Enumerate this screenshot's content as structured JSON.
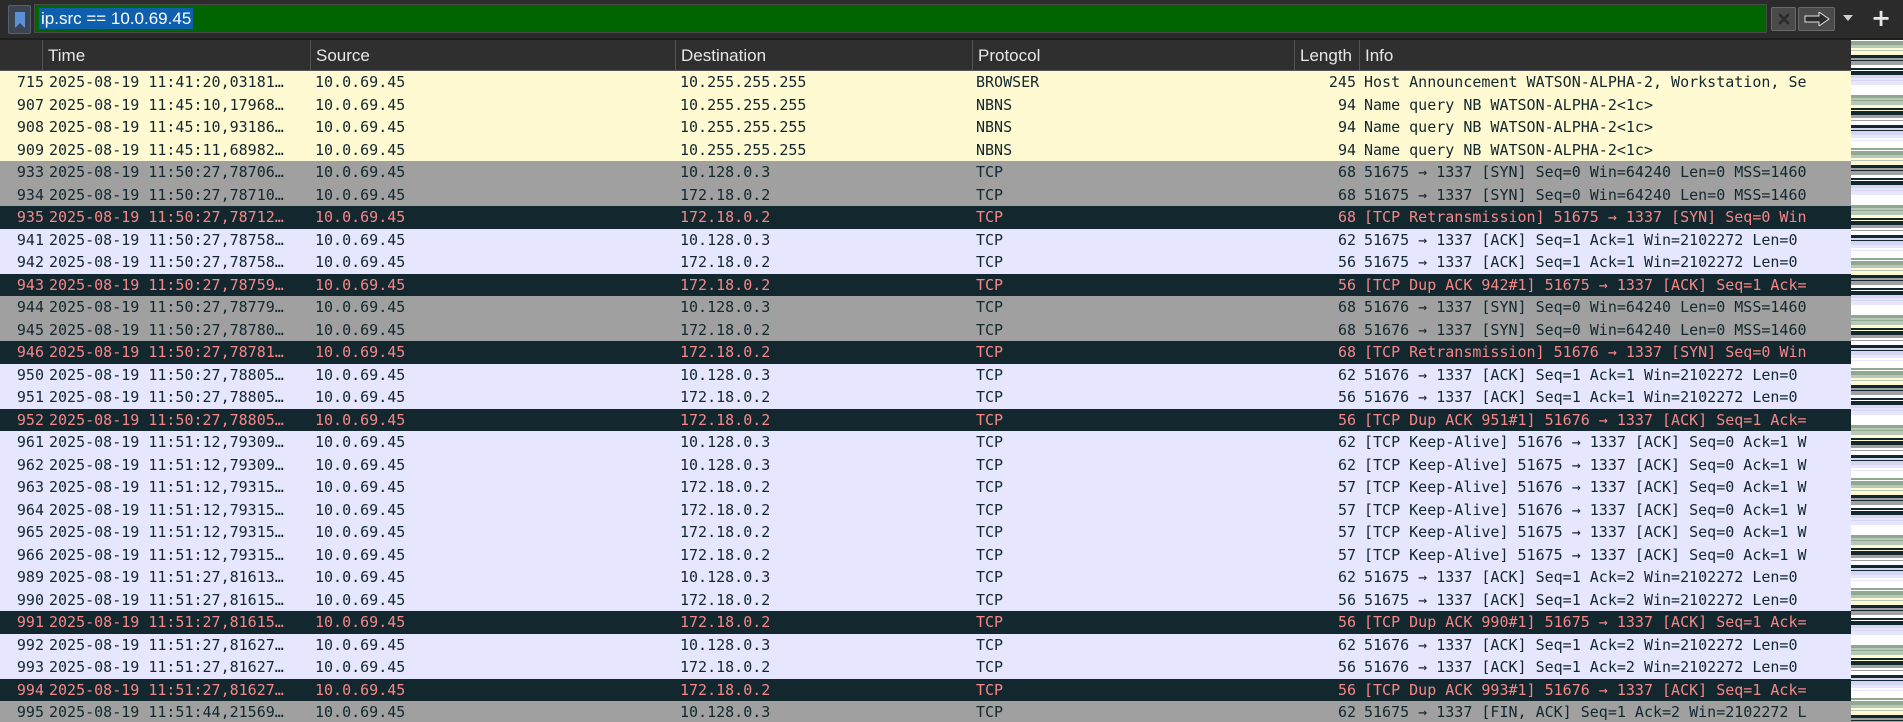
{
  "filter": {
    "value": "ip.src == 10.0.69.45",
    "bookmark_icon": "bookmark-icon",
    "clear_icon": "clear-x-icon",
    "apply_icon": "arrow-right-icon",
    "dropdown_icon": "chevron-down-icon",
    "add_icon": "plus-icon",
    "background_color": "#006400"
  },
  "columns": {
    "no": "",
    "time": "Time",
    "source": "Source",
    "destination": "Destination",
    "protocol": "Protocol",
    "length": "Length",
    "info": "Info"
  },
  "colors": {
    "yellow": "#fffad2",
    "gray": "#a0a0a0",
    "lavender": "#e7e6ff",
    "dark": "#12272e",
    "dark_text": "#f78787"
  },
  "packets": [
    {
      "no": "715",
      "time": "2025-08-19 11:41:20,03181…",
      "src": "10.0.69.45",
      "dst": "10.255.255.255",
      "proto": "BROWSER",
      "len": "245",
      "info": "Host Announcement WATSON-ALPHA-2, Workstation, Se",
      "style": "yellow"
    },
    {
      "no": "907",
      "time": "2025-08-19 11:45:10,17968…",
      "src": "10.0.69.45",
      "dst": "10.255.255.255",
      "proto": "NBNS",
      "len": "94",
      "info": "Name query NB WATSON-ALPHA-2<1c>",
      "style": "yellow"
    },
    {
      "no": "908",
      "time": "2025-08-19 11:45:10,93186…",
      "src": "10.0.69.45",
      "dst": "10.255.255.255",
      "proto": "NBNS",
      "len": "94",
      "info": "Name query NB WATSON-ALPHA-2<1c>",
      "style": "yellow"
    },
    {
      "no": "909",
      "time": "2025-08-19 11:45:11,68982…",
      "src": "10.0.69.45",
      "dst": "10.255.255.255",
      "proto": "NBNS",
      "len": "94",
      "info": "Name query NB WATSON-ALPHA-2<1c>",
      "style": "yellow"
    },
    {
      "no": "933",
      "time": "2025-08-19 11:50:27,78706…",
      "src": "10.0.69.45",
      "dst": "10.128.0.3",
      "proto": "TCP",
      "len": "68",
      "info": "51675 → 1337 [SYN] Seq=0 Win=64240 Len=0 MSS=1460",
      "style": "gray"
    },
    {
      "no": "934",
      "time": "2025-08-19 11:50:27,78710…",
      "src": "10.0.69.45",
      "dst": "172.18.0.2",
      "proto": "TCP",
      "len": "68",
      "info": "51675 → 1337 [SYN] Seq=0 Win=64240 Len=0 MSS=1460",
      "style": "gray"
    },
    {
      "no": "935",
      "time": "2025-08-19 11:50:27,78712…",
      "src": "10.0.69.45",
      "dst": "172.18.0.2",
      "proto": "TCP",
      "len": "68",
      "info": "[TCP Retransmission] 51675 → 1337 [SYN] Seq=0 Win",
      "style": "dark"
    },
    {
      "no": "941",
      "time": "2025-08-19 11:50:27,78758…",
      "src": "10.0.69.45",
      "dst": "10.128.0.3",
      "proto": "TCP",
      "len": "62",
      "info": "51675 → 1337 [ACK] Seq=1 Ack=1 Win=2102272 Len=0",
      "style": "lav"
    },
    {
      "no": "942",
      "time": "2025-08-19 11:50:27,78758…",
      "src": "10.0.69.45",
      "dst": "172.18.0.2",
      "proto": "TCP",
      "len": "56",
      "info": "51675 → 1337 [ACK] Seq=1 Ack=1 Win=2102272 Len=0",
      "style": "lav"
    },
    {
      "no": "943",
      "time": "2025-08-19 11:50:27,78759…",
      "src": "10.0.69.45",
      "dst": "172.18.0.2",
      "proto": "TCP",
      "len": "56",
      "info": "[TCP Dup ACK 942#1] 51675 → 1337 [ACK] Seq=1 Ack=",
      "style": "dark"
    },
    {
      "no": "944",
      "time": "2025-08-19 11:50:27,78779…",
      "src": "10.0.69.45",
      "dst": "10.128.0.3",
      "proto": "TCP",
      "len": "68",
      "info": "51676 → 1337 [SYN] Seq=0 Win=64240 Len=0 MSS=1460",
      "style": "gray"
    },
    {
      "no": "945",
      "time": "2025-08-19 11:50:27,78780…",
      "src": "10.0.69.45",
      "dst": "172.18.0.2",
      "proto": "TCP",
      "len": "68",
      "info": "51676 → 1337 [SYN] Seq=0 Win=64240 Len=0 MSS=1460",
      "style": "gray"
    },
    {
      "no": "946",
      "time": "2025-08-19 11:50:27,78781…",
      "src": "10.0.69.45",
      "dst": "172.18.0.2",
      "proto": "TCP",
      "len": "68",
      "info": "[TCP Retransmission] 51676 → 1337 [SYN] Seq=0 Win",
      "style": "dark"
    },
    {
      "no": "950",
      "time": "2025-08-19 11:50:27,78805…",
      "src": "10.0.69.45",
      "dst": "10.128.0.3",
      "proto": "TCP",
      "len": "62",
      "info": "51676 → 1337 [ACK] Seq=1 Ack=1 Win=2102272 Len=0",
      "style": "lav"
    },
    {
      "no": "951",
      "time": "2025-08-19 11:50:27,78805…",
      "src": "10.0.69.45",
      "dst": "172.18.0.2",
      "proto": "TCP",
      "len": "56",
      "info": "51676 → 1337 [ACK] Seq=1 Ack=1 Win=2102272 Len=0",
      "style": "lav"
    },
    {
      "no": "952",
      "time": "2025-08-19 11:50:27,78805…",
      "src": "10.0.69.45",
      "dst": "172.18.0.2",
      "proto": "TCP",
      "len": "56",
      "info": "[TCP Dup ACK 951#1] 51676 → 1337 [ACK] Seq=1 Ack=",
      "style": "dark"
    },
    {
      "no": "961",
      "time": "2025-08-19 11:51:12,79309…",
      "src": "10.0.69.45",
      "dst": "10.128.0.3",
      "proto": "TCP",
      "len": "62",
      "info": "[TCP Keep-Alive] 51676 → 1337 [ACK] Seq=0 Ack=1 W",
      "style": "lav"
    },
    {
      "no": "962",
      "time": "2025-08-19 11:51:12,79309…",
      "src": "10.0.69.45",
      "dst": "10.128.0.3",
      "proto": "TCP",
      "len": "62",
      "info": "[TCP Keep-Alive] 51675 → 1337 [ACK] Seq=0 Ack=1 W",
      "style": "lav"
    },
    {
      "no": "963",
      "time": "2025-08-19 11:51:12,79315…",
      "src": "10.0.69.45",
      "dst": "172.18.0.2",
      "proto": "TCP",
      "len": "57",
      "info": "[TCP Keep-Alive] 51676 → 1337 [ACK] Seq=0 Ack=1 W",
      "style": "lav"
    },
    {
      "no": "964",
      "time": "2025-08-19 11:51:12,79315…",
      "src": "10.0.69.45",
      "dst": "172.18.0.2",
      "proto": "TCP",
      "len": "57",
      "info": "[TCP Keep-Alive] 51676 → 1337 [ACK] Seq=0 Ack=1 W",
      "style": "lav"
    },
    {
      "no": "965",
      "time": "2025-08-19 11:51:12,79315…",
      "src": "10.0.69.45",
      "dst": "172.18.0.2",
      "proto": "TCP",
      "len": "57",
      "info": "[TCP Keep-Alive] 51675 → 1337 [ACK] Seq=0 Ack=1 W",
      "style": "lav"
    },
    {
      "no": "966",
      "time": "2025-08-19 11:51:12,79315…",
      "src": "10.0.69.45",
      "dst": "172.18.0.2",
      "proto": "TCP",
      "len": "57",
      "info": "[TCP Keep-Alive] 51675 → 1337 [ACK] Seq=0 Ack=1 W",
      "style": "lav"
    },
    {
      "no": "989",
      "time": "2025-08-19 11:51:27,81613…",
      "src": "10.0.69.45",
      "dst": "10.128.0.3",
      "proto": "TCP",
      "len": "62",
      "info": "51675 → 1337 [ACK] Seq=1 Ack=2 Win=2102272 Len=0",
      "style": "lav"
    },
    {
      "no": "990",
      "time": "2025-08-19 11:51:27,81615…",
      "src": "10.0.69.45",
      "dst": "172.18.0.2",
      "proto": "TCP",
      "len": "56",
      "info": "51675 → 1337 [ACK] Seq=1 Ack=2 Win=2102272 Len=0",
      "style": "lav"
    },
    {
      "no": "991",
      "time": "2025-08-19 11:51:27,81615…",
      "src": "10.0.69.45",
      "dst": "172.18.0.2",
      "proto": "TCP",
      "len": "56",
      "info": "[TCP Dup ACK 990#1] 51675 → 1337 [ACK] Seq=1 Ack=",
      "style": "dark"
    },
    {
      "no": "992",
      "time": "2025-08-19 11:51:27,81627…",
      "src": "10.0.69.45",
      "dst": "10.128.0.3",
      "proto": "TCP",
      "len": "62",
      "info": "51676 → 1337 [ACK] Seq=1 Ack=2 Win=2102272 Len=0",
      "style": "lav"
    },
    {
      "no": "993",
      "time": "2025-08-19 11:51:27,81627…",
      "src": "10.0.69.45",
      "dst": "172.18.0.2",
      "proto": "TCP",
      "len": "56",
      "info": "51676 → 1337 [ACK] Seq=1 Ack=2 Win=2102272 Len=0",
      "style": "lav"
    },
    {
      "no": "994",
      "time": "2025-08-19 11:51:27,81627…",
      "src": "10.0.69.45",
      "dst": "172.18.0.2",
      "proto": "TCP",
      "len": "56",
      "info": "[TCP Dup ACK 993#1] 51676 → 1337 [ACK] Seq=1 Ack=",
      "style": "dark"
    },
    {
      "no": "995",
      "time": "2025-08-19 11:51:44,21569…",
      "src": "10.0.69.45",
      "dst": "10.128.0.3",
      "proto": "TCP",
      "len": "62",
      "info": "51675 → 1337 [FIN, ACK] Seq=1 Ack=2 Win=2102272 L",
      "style": "gray"
    }
  ]
}
